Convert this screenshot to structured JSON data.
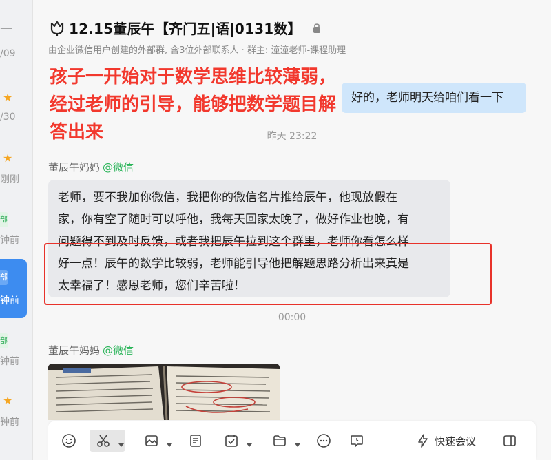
{
  "left_list": {
    "times": [
      "/09",
      "/30",
      "刚刚",
      "钟前",
      "钟前",
      "钟前",
      "钟前"
    ],
    "tag": "部",
    "star": "★",
    "collapse": "—"
  },
  "header": {
    "title": "12.15董辰午【齐门五|语|0131数】",
    "subtitle": "由企业微信用户创建的外部群, 含3位外部联系人 · 群主: 潼潼老师-课程助理"
  },
  "annotation": {
    "line1": "孩子一开始对于数学思维比较薄弱，",
    "line2": "经过老师的引导，能够把数学题目解",
    "line3": "答出来"
  },
  "messages": {
    "sent_text": "好的，老师明天给咱们看一下",
    "timestamp1": "昨天 23:22",
    "sender1": "董辰午妈妈",
    "sender1_via": "@微信",
    "recv_lines": [
      "老师，要不我加你微信，我把你的微信名片推给辰午，他现放假在",
      "家，你有空了随时可以呼他，我每天回家太晚了，做好作业也晚，有",
      "问题得不到及时反馈，或者我把辰午拉到这个群里，老师你看怎么样",
      "好一点！辰午的数学比较弱，老师能引导他把解题思路分析出来真是",
      "太幸福了！感恩老师，您们辛苦啦！"
    ],
    "timestamp2": "00:00",
    "sender2": "董辰午妈妈",
    "sender2_via": "@微信"
  },
  "toolbar": {
    "icons": [
      "emoji-icon",
      "scissors-icon",
      "image-icon",
      "document-icon",
      "task-icon",
      "folder-icon",
      "more-icon",
      "schedule-icon",
      "lightning-icon",
      "sidebar-icon"
    ],
    "meeting_label": "快速会议"
  },
  "colors": {
    "accent": "#3d8cf0",
    "annotation_red": "#f2382d",
    "wechat_green": "#29b458",
    "sent_bubble": "#cfe6fb",
    "recv_bubble": "#e8e9ec"
  }
}
